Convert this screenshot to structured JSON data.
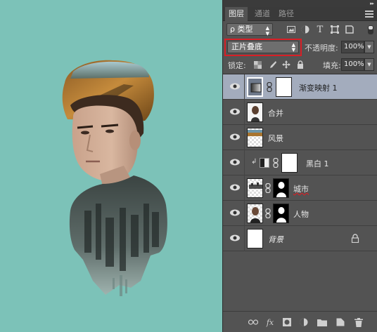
{
  "colors": {
    "canvas_bg": "#7cc2b8",
    "panel_bg": "#535353",
    "selection_bg": "#a3acbd",
    "highlight_border": "#d81f26"
  },
  "panel": {
    "tabs": [
      {
        "label": "图层",
        "active": true
      },
      {
        "label": "通道",
        "active": false
      },
      {
        "label": "路径",
        "active": false
      }
    ],
    "filter": {
      "kind_label": "ρ 类型",
      "icons": [
        "image-filter-icon",
        "adjustment-filter-icon",
        "type-filter-icon",
        "shape-filter-icon",
        "smart-object-filter-icon"
      ]
    },
    "blend_mode": "正片叠底",
    "opacity_label": "不透明度:",
    "opacity_value": "100%",
    "lock_label": "锁定:",
    "lock_icons": [
      "lock-transparent-icon",
      "lock-paint-icon",
      "lock-move-icon",
      "lock-all-icon"
    ],
    "fill_label": "填充:",
    "fill_value": "100%",
    "layers": [
      {
        "name": "渐变映射 1",
        "thumb": "gradient-map-adjustment",
        "mask": true,
        "selected": true,
        "clipped": false
      },
      {
        "name": "合并",
        "thumb": "portrait-merged",
        "mask": false,
        "selected": false,
        "clipped": false
      },
      {
        "name": "风景",
        "thumb": "landscape",
        "mask": false,
        "selected": false,
        "clipped": false
      },
      {
        "name": "黑白 1",
        "thumb": "black-white-adjustment",
        "mask": true,
        "selected": false,
        "clipped": true
      },
      {
        "name": "城市",
        "thumb": "city",
        "mask": true,
        "selected": false,
        "clipped": false
      },
      {
        "name": "人物",
        "thumb": "person",
        "mask": true,
        "selected": false,
        "clipped": false
      },
      {
        "name": "背景",
        "thumb": "white-background",
        "mask": false,
        "selected": false,
        "locked": true
      }
    ],
    "bottom_icons": [
      "link-layers-icon",
      "fx-icon",
      "add-mask-icon",
      "new-adjustment-icon",
      "new-group-icon",
      "new-layer-icon",
      "delete-layer-icon"
    ],
    "fx_label": "fx"
  }
}
